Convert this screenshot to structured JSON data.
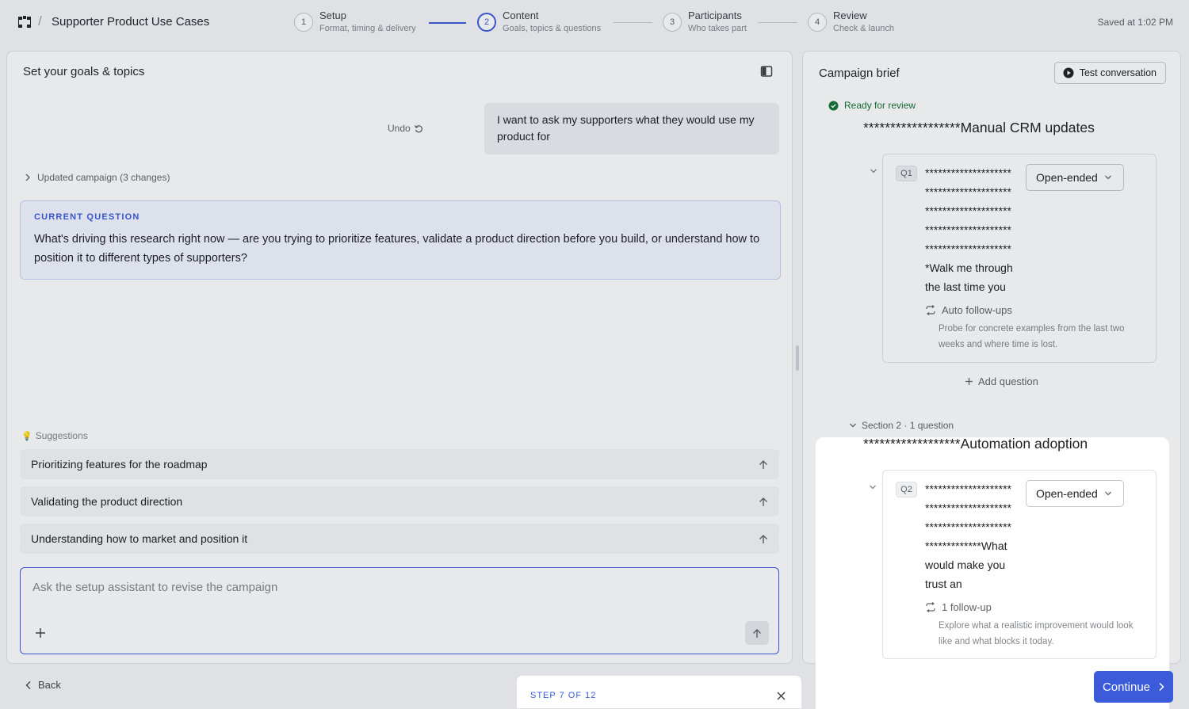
{
  "header": {
    "breadcrumb_separator": "/",
    "title": "Supporter Product Use Cases",
    "saved": "Saved at 1:02 PM",
    "steps": [
      {
        "num": "1",
        "title": "Setup",
        "sub": "Format, timing & delivery"
      },
      {
        "num": "2",
        "title": "Content",
        "sub": "Goals, topics & questions"
      },
      {
        "num": "3",
        "title": "Participants",
        "sub": "Who takes part"
      },
      {
        "num": "4",
        "title": "Review",
        "sub": "Check & launch"
      }
    ],
    "active_step": 2
  },
  "chat": {
    "title": "Set your goals & topics",
    "user_message": "I want to ask my supporters what they would use my product for",
    "undo_label": "Undo",
    "updated_label": "Updated campaign (3 changes)",
    "current_question_label": "CURRENT QUESTION",
    "current_question_text": "What's driving this research right now — are you trying to prioritize features, validate a product direction before you build, or understand how to position it to different types of supporters?",
    "suggestions_label": "Suggestions",
    "suggestions": [
      "Prioritizing features for the roadmap",
      "Validating the product direction",
      "Understanding how to market and position it"
    ],
    "composer_placeholder": "Ask the setup assistant to revise the campaign"
  },
  "brief": {
    "title": "Campaign brief",
    "test_button": "Test conversation",
    "status": "Ready for review",
    "section1_title": "******************Manual CRM updates",
    "q1": {
      "badge": "Q1",
      "text_lines": [
        "********************",
        "********************",
        "********************",
        "********************",
        "********************",
        "*Walk me through",
        "the last time you"
      ],
      "type": "Open-ended",
      "followup_label": "Auto follow-ups",
      "followup_desc": "Probe for concrete examples from the last two weeks and where time is lost."
    },
    "add_question": "Add question",
    "section2_meta": "Section 2 · 1 question",
    "section2_title": "******************Automation adoption",
    "q2": {
      "badge": "Q2",
      "text_lines": [
        "********************",
        "********************",
        "********************",
        "*************What",
        "would make you",
        "trust an"
      ],
      "type": "Open-ended",
      "followup_label": "1 follow-up",
      "followup_desc": "Explore what a realistic improvement would look like and what blocks it today."
    }
  },
  "footer": {
    "back": "Back",
    "tour_step": "STEP 7 OF 12",
    "continue": "Continue"
  },
  "colors": {
    "accent": "#3b5bdb",
    "success": "#137333"
  }
}
